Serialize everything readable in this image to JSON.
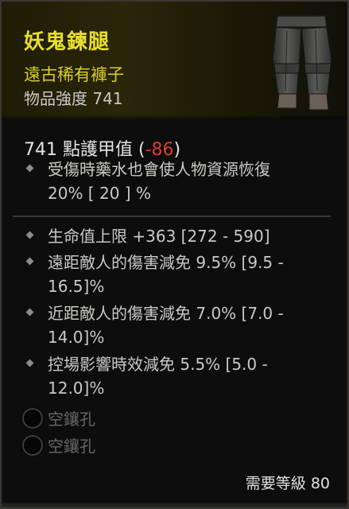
{
  "item": {
    "name": "妖鬼鍊腿",
    "type": "遠古稀有褲子",
    "power": "物品強度 741",
    "icon": "pants-item-icon",
    "rarity_color": "#e8de2a"
  },
  "armor": {
    "label": "741 點護甲值",
    "delta_open": " (",
    "delta": "-86",
    "delta_close": ")",
    "delta_color": "#e13a2d"
  },
  "implicit": {
    "line1": "受傷時藥水也會使人物資源恢復",
    "line2": "20%   [ 20 ] %"
  },
  "affixes": [
    {
      "line1": "生命值上限 +363 [272 - 590]",
      "line2": ""
    },
    {
      "line1": "遠距敵人的傷害減免 9.5% [9.5 -",
      "line2": "16.5]%"
    },
    {
      "line1": "近距敵人的傷害減免 7.0% [7.0 -",
      "line2": "14.0]%"
    },
    {
      "line1": "控場影響時效減免 5.5% [5.0 -",
      "line2": "12.0]%"
    }
  ],
  "sockets": [
    {
      "label": "空鑲孔"
    },
    {
      "label": "空鑲孔"
    }
  ],
  "requirement": "需要等級 80"
}
